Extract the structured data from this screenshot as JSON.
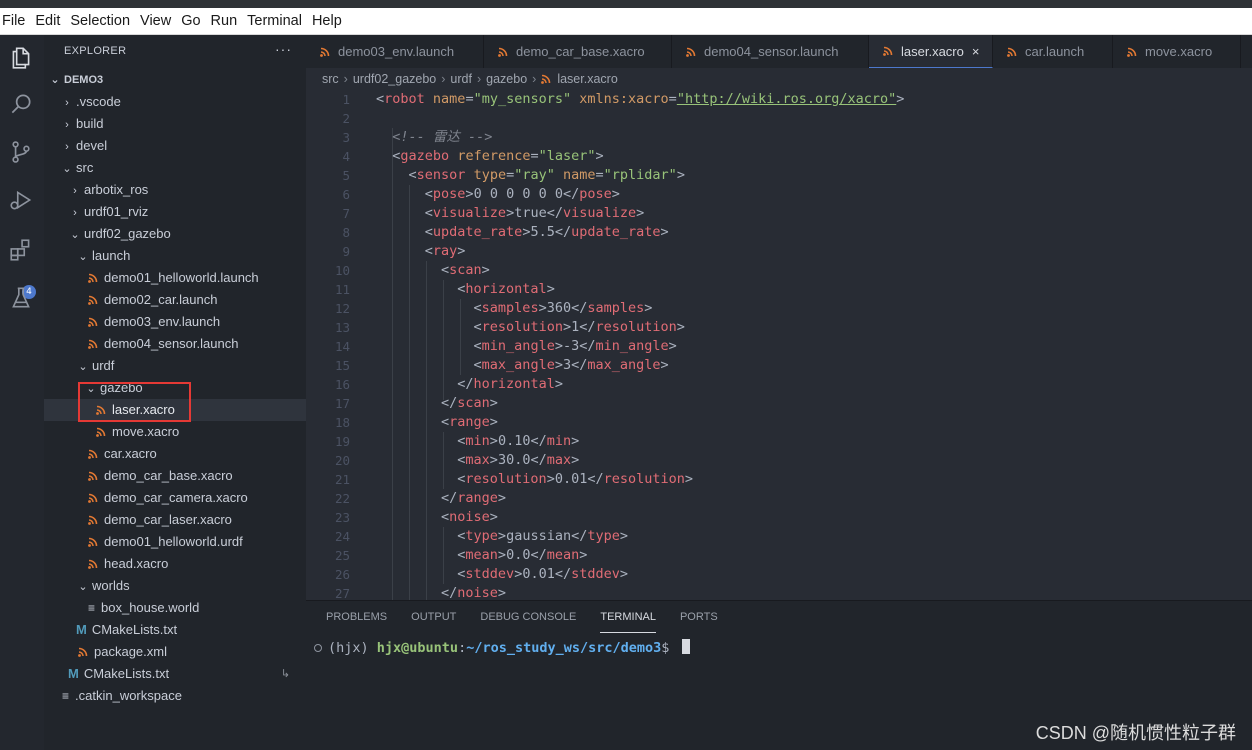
{
  "menubar": {
    "items": [
      "File",
      "Edit",
      "Selection",
      "View",
      "Go",
      "Run",
      "Terminal",
      "Help"
    ]
  },
  "activity": {
    "extensions_badge": "4"
  },
  "explorer": {
    "title": "EXPLORER",
    "more": "···",
    "root": "DEMO3",
    "items": [
      {
        "label": ".vscode",
        "kind": "folder-closed"
      },
      {
        "label": "build",
        "kind": "folder-closed"
      },
      {
        "label": "devel",
        "kind": "folder-closed"
      },
      {
        "label": "src",
        "kind": "folder-open"
      },
      {
        "label": "arbotix_ros",
        "kind": "folder-closed"
      },
      {
        "label": "urdf01_rviz",
        "kind": "folder-closed"
      },
      {
        "label": "urdf02_gazebo",
        "kind": "folder-open"
      },
      {
        "label": "launch",
        "kind": "folder-open"
      },
      {
        "label": "demo01_helloworld.launch",
        "kind": "rss"
      },
      {
        "label": "demo02_car.launch",
        "kind": "rss"
      },
      {
        "label": "demo03_env.launch",
        "kind": "rss"
      },
      {
        "label": "demo04_sensor.launch",
        "kind": "rss"
      },
      {
        "label": "urdf",
        "kind": "folder-open"
      },
      {
        "label": "gazebo",
        "kind": "folder-open"
      },
      {
        "label": "laser.xacro",
        "kind": "rss"
      },
      {
        "label": "move.xacro",
        "kind": "rss"
      },
      {
        "label": "car.xacro",
        "kind": "rss"
      },
      {
        "label": "demo_car_base.xacro",
        "kind": "rss"
      },
      {
        "label": "demo_car_camera.xacro",
        "kind": "rss"
      },
      {
        "label": "demo_car_laser.xacro",
        "kind": "rss"
      },
      {
        "label": "demo01_helloworld.urdf",
        "kind": "rss"
      },
      {
        "label": "head.xacro",
        "kind": "rss"
      },
      {
        "label": "worlds",
        "kind": "folder-open"
      },
      {
        "label": "box_house.world",
        "kind": "text"
      },
      {
        "label": "CMakeLists.txt",
        "kind": "cmake"
      },
      {
        "label": "package.xml",
        "kind": "rss"
      },
      {
        "label": "CMakeLists.txt",
        "kind": "cmake"
      },
      {
        "label": ".catkin_workspace",
        "kind": "text"
      }
    ]
  },
  "tabs": [
    {
      "label": "demo03_env.launch",
      "active": false
    },
    {
      "label": "demo_car_base.xacro",
      "active": false
    },
    {
      "label": "demo04_sensor.launch",
      "active": false
    },
    {
      "label": "laser.xacro",
      "active": true,
      "close": "×"
    },
    {
      "label": "car.launch",
      "active": false
    },
    {
      "label": "move.xacro",
      "active": false
    }
  ],
  "breadcrumb": [
    "src",
    "urdf02_gazebo",
    "urdf",
    "gazebo",
    "laser.xacro"
  ],
  "editor": {
    "line_numbers": [
      "1",
      "2",
      "3",
      "4",
      "5",
      "6",
      "7",
      "8",
      "9",
      "10",
      "11",
      "12",
      "13",
      "14",
      "15",
      "16",
      "17",
      "18",
      "19",
      "20",
      "21",
      "22",
      "23",
      "24",
      "25",
      "26",
      "27"
    ],
    "code": {
      "l1_tag": "robot",
      "l1_attr1": "name",
      "l1_val1": "\"my_sensors\"",
      "l1_attr2": "xmlns:xacro",
      "l1_val2": "\"http://wiki.ros.org/xacro\"",
      "l3_comment": "<!-- 雷达 -->",
      "l4_tag": "gazebo",
      "l4_attr": "reference",
      "l4_val": "\"laser\"",
      "l5_tag": "sensor",
      "l5_attr1": "type",
      "l5_val1": "\"ray\"",
      "l5_attr2": "name",
      "l5_val2": "\"rplidar\"",
      "l6_tag": "pose",
      "l6_text": "0 0 0 0 0 0",
      "l7_tag": "visualize",
      "l7_text": "true",
      "l8_tag": "update_rate",
      "l8_text": "5.5",
      "l9_tag": "ray",
      "l10_tag": "scan",
      "l11_tag": "horizontal",
      "l12_tag": "samples",
      "l12_text": "360",
      "l13_tag": "resolution",
      "l13_text": "1",
      "l14_tag": "min_angle",
      "l14_text": "-3",
      "l15_tag": "max_angle",
      "l15_text": "3",
      "l16_tag": "horizontal",
      "l17_tag": "scan",
      "l18_tag": "range",
      "l19_tag": "min",
      "l19_text": "0.10",
      "l20_tag": "max",
      "l20_text": "30.0",
      "l21_tag": "resolution",
      "l21_text": "0.01",
      "l22_tag": "range",
      "l23_tag": "noise",
      "l24_tag": "type",
      "l24_text": "gaussian",
      "l25_tag": "mean",
      "l25_text": "0.0",
      "l26_tag": "stddev",
      "l26_text": "0.01",
      "l27_tag": "noise"
    }
  },
  "panel": {
    "tabs": [
      "PROBLEMS",
      "OUTPUT",
      "DEBUG CONSOLE",
      "TERMINAL",
      "PORTS"
    ],
    "active_tab": "TERMINAL",
    "prompt_env": "(hjx) ",
    "prompt_user": "hjx@ubuntu",
    "prompt_colon": ":",
    "prompt_path": "~/ros_study_ws/src/demo3",
    "prompt_dollar": "$ "
  },
  "watermark": "CSDN @随机惯性粒子群",
  "colors": {
    "accent": "#4d78cc",
    "rss_icon": "#e37933",
    "highlight_box": "#e53935"
  }
}
